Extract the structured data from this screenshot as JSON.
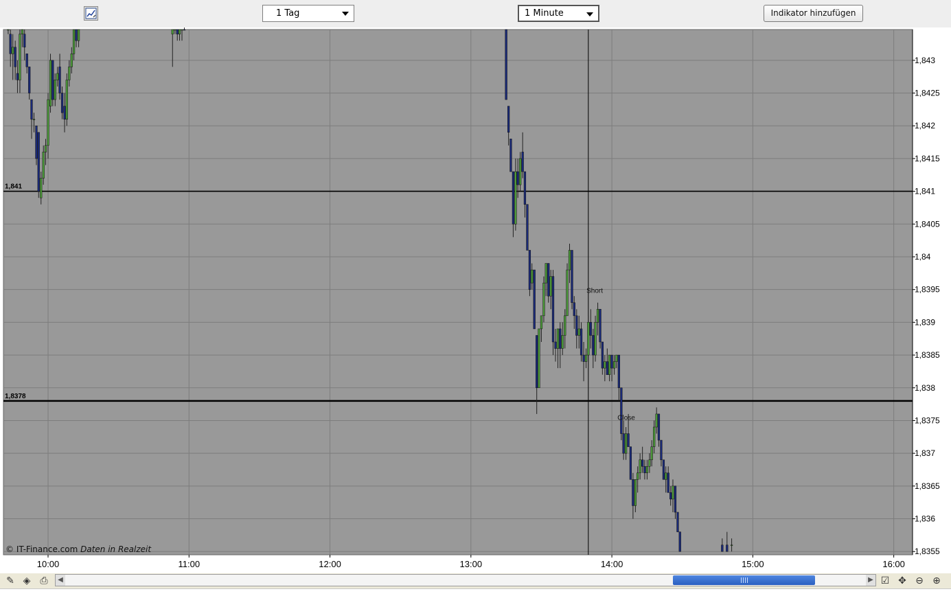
{
  "toolbar": {
    "range_value": "1 Tag",
    "interval_value": "1 Minute",
    "indicator_button": "Indikator hinzufügen"
  },
  "credit": {
    "copyright": "© IT-Finance.com",
    "realtime": "Daten in Realzeit"
  },
  "colors": {
    "plot_bg": "#999999",
    "grid": "#7d7d7d",
    "up_candle": "#4c9a3a",
    "down_candle": "#1a2a78",
    "line": "#000000"
  },
  "chart_data": {
    "type": "candlestick",
    "y_ticks": [
      "1,843",
      "1,8425",
      "1,842",
      "1,8415",
      "1,841",
      "1,8405",
      "1,84",
      "1,8395",
      "1,839",
      "1,8385",
      "1,838",
      "1,8375",
      "1,837",
      "1,8365",
      "1,836",
      "1,8355"
    ],
    "ylim": [
      1.83545,
      1.84347
    ],
    "x_ticks": [
      "10:00",
      "11:00",
      "12:00",
      "13:00",
      "14:00",
      "15:00",
      "16:00"
    ],
    "xlim_hours": [
      9.6833,
      16.1333
    ],
    "hlines": [
      {
        "value": 1.841,
        "label": "1,841"
      },
      {
        "value": 1.8378,
        "label": "1,8378"
      }
    ],
    "vline_time": 13.833,
    "annotations": [
      {
        "text": "Short",
        "time": 13.82,
        "price": 1.83945
      },
      {
        "text": "Close",
        "time": 14.04,
        "price": 1.83751
      }
    ],
    "candles": [
      [
        9.717,
        1.8435,
        1.8436,
        1.8434,
        1.8435
      ],
      [
        9.733,
        1.8434,
        1.8435,
        1.8429,
        1.8431
      ],
      [
        9.75,
        1.8431,
        1.8434,
        1.8427,
        1.8432
      ],
      [
        9.767,
        1.8432,
        1.8433,
        1.8427,
        1.8429
      ],
      [
        9.783,
        1.8428,
        1.843,
        1.8425,
        1.8427
      ],
      [
        9.8,
        1.8427,
        1.8435,
        1.8425,
        1.8434
      ],
      [
        9.817,
        1.8434,
        1.8436,
        1.8432,
        1.8435
      ],
      [
        9.833,
        1.8434,
        1.8435,
        1.843,
        1.8432
      ],
      [
        9.85,
        1.8431,
        1.8431,
        1.8428,
        1.8429
      ],
      [
        9.867,
        1.8429,
        1.8429,
        1.8424,
        1.8425
      ],
      [
        9.883,
        1.8424,
        1.8424,
        1.8418,
        1.8421
      ],
      [
        9.9,
        1.8421,
        1.8422,
        1.8419,
        1.8421
      ],
      [
        9.917,
        1.842,
        1.842,
        1.8414,
        1.8415
      ],
      [
        9.933,
        1.8419,
        1.8419,
        1.8409,
        1.841
      ],
      [
        9.95,
        1.8409,
        1.8413,
        1.8408,
        1.8412
      ],
      [
        9.967,
        1.8412,
        1.8417,
        1.8411,
        1.8416
      ],
      [
        9.983,
        1.8416,
        1.8418,
        1.8414,
        1.8417
      ],
      [
        10.0,
        1.8417,
        1.8425,
        1.8415,
        1.8424
      ],
      [
        10.017,
        1.8423,
        1.8431,
        1.8422,
        1.843
      ],
      [
        10.033,
        1.843,
        1.843,
        1.8423,
        1.8424
      ],
      [
        10.05,
        1.8424,
        1.8428,
        1.8423,
        1.8427
      ],
      [
        10.067,
        1.8427,
        1.8429,
        1.8426,
        1.8428
      ],
      [
        10.083,
        1.8429,
        1.8431,
        1.8424,
        1.8425
      ],
      [
        10.1,
        1.8425,
        1.8426,
        1.8421,
        1.8422
      ],
      [
        10.117,
        1.8423,
        1.8425,
        1.8419,
        1.8421
      ],
      [
        10.133,
        1.8421,
        1.8428,
        1.842,
        1.8427
      ],
      [
        10.15,
        1.8427,
        1.843,
        1.8426,
        1.8429
      ],
      [
        10.167,
        1.8429,
        1.8432,
        1.8428,
        1.8431
      ],
      [
        10.183,
        1.8431,
        1.8436,
        1.843,
        1.8435
      ],
      [
        10.2,
        1.8435,
        1.8436,
        1.8432,
        1.8433
      ],
      [
        10.217,
        1.8433,
        1.8436,
        1.8432,
        1.8436
      ],
      [
        10.883,
        1.8434,
        1.8436,
        1.8429,
        1.8435
      ],
      [
        10.9,
        1.8435,
        1.8436,
        1.8434,
        1.8436
      ],
      [
        10.917,
        1.8436,
        1.8437,
        1.8433,
        1.8434
      ],
      [
        10.933,
        1.8434,
        1.8436,
        1.8433,
        1.8435
      ],
      [
        10.95,
        1.8435,
        1.8436,
        1.8433,
        1.8435
      ],
      [
        10.967,
        1.8436,
        1.8437,
        1.8435,
        1.8435
      ],
      [
        13.25,
        1.8437,
        1.8437,
        1.8424,
        1.8424
      ],
      [
        13.267,
        1.8423,
        1.8423,
        1.8417,
        1.8419
      ],
      [
        13.283,
        1.8418,
        1.8418,
        1.8413,
        1.8413
      ],
      [
        13.3,
        1.8413,
        1.8413,
        1.8403,
        1.8405
      ],
      [
        13.317,
        1.8405,
        1.8415,
        1.8404,
        1.8413
      ],
      [
        13.333,
        1.8413,
        1.8415,
        1.8409,
        1.8411
      ],
      [
        13.35,
        1.8411,
        1.8416,
        1.841,
        1.8415
      ],
      [
        13.367,
        1.8416,
        1.8419,
        1.8412,
        1.8413
      ],
      [
        13.383,
        1.8413,
        1.8413,
        1.8406,
        1.8408
      ],
      [
        13.4,
        1.8408,
        1.8408,
        1.8401,
        1.8401
      ],
      [
        13.417,
        1.8401,
        1.8401,
        1.8394,
        1.8395
      ],
      [
        13.433,
        1.8396,
        1.8399,
        1.8395,
        1.8398
      ],
      [
        13.45,
        1.8398,
        1.8398,
        1.8389,
        1.8389
      ],
      [
        13.467,
        1.8388,
        1.8388,
        1.8376,
        1.838
      ],
      [
        13.483,
        1.838,
        1.8389,
        1.838,
        1.8389
      ],
      [
        13.5,
        1.8389,
        1.8391,
        1.8387,
        1.8391
      ],
      [
        13.517,
        1.8391,
        1.8397,
        1.839,
        1.8396
      ],
      [
        13.533,
        1.8396,
        1.8399,
        1.8394,
        1.8399
      ],
      [
        13.55,
        1.8399,
        1.8399,
        1.8393,
        1.8394
      ],
      [
        13.567,
        1.8394,
        1.8398,
        1.8392,
        1.8397
      ],
      [
        13.583,
        1.8397,
        1.8398,
        1.8385,
        1.8387
      ],
      [
        13.6,
        1.8387,
        1.8389,
        1.8384,
        1.8386
      ],
      [
        13.617,
        1.8386,
        1.8389,
        1.8383,
        1.8389
      ],
      [
        13.633,
        1.8389,
        1.839,
        1.8383,
        1.8386
      ],
      [
        13.65,
        1.8386,
        1.839,
        1.8385,
        1.8388
      ],
      [
        13.667,
        1.8388,
        1.8392,
        1.8386,
        1.8391
      ],
      [
        13.683,
        1.8391,
        1.8399,
        1.8391,
        1.8398
      ],
      [
        13.7,
        1.8398,
        1.8402,
        1.8396,
        1.8401
      ],
      [
        13.717,
        1.8401,
        1.8401,
        1.8392,
        1.8393
      ],
      [
        13.733,
        1.8393,
        1.8394,
        1.8389,
        1.8391
      ],
      [
        13.75,
        1.8391,
        1.8392,
        1.8386,
        1.8388
      ],
      [
        13.767,
        1.8388,
        1.8391,
        1.8386,
        1.8389
      ],
      [
        13.783,
        1.8389,
        1.839,
        1.8384,
        1.8385
      ],
      [
        13.8,
        1.8385,
        1.8387,
        1.8381,
        1.8384
      ],
      [
        13.817,
        1.8384,
        1.8386,
        1.8383,
        1.8385
      ],
      [
        13.833,
        1.8385,
        1.8391,
        1.8384,
        1.839
      ],
      [
        13.85,
        1.839,
        1.8392,
        1.8386,
        1.8388
      ],
      [
        13.867,
        1.8388,
        1.8389,
        1.8383,
        1.8385
      ],
      [
        13.883,
        1.8385,
        1.8391,
        1.8384,
        1.839
      ],
      [
        13.9,
        1.839,
        1.8393,
        1.8388,
        1.8392
      ],
      [
        13.917,
        1.8392,
        1.8392,
        1.8386,
        1.8387
      ],
      [
        13.933,
        1.8387,
        1.8387,
        1.8382,
        1.8383
      ],
      [
        13.95,
        1.8383,
        1.8385,
        1.8381,
        1.8384
      ],
      [
        13.967,
        1.8384,
        1.8386,
        1.8382,
        1.8382
      ],
      [
        13.983,
        1.8382,
        1.8385,
        1.8381,
        1.8385
      ],
      [
        14.0,
        1.8385,
        1.8385,
        1.8381,
        1.8383
      ],
      [
        14.017,
        1.8383,
        1.8385,
        1.8382,
        1.8384
      ],
      [
        14.033,
        1.8384,
        1.8385,
        1.8383,
        1.8385
      ],
      [
        14.05,
        1.8385,
        1.8385,
        1.8378,
        1.838
      ],
      [
        14.067,
        1.838,
        1.838,
        1.8372,
        1.8373
      ],
      [
        14.083,
        1.8373,
        1.8375,
        1.8369,
        1.837
      ],
      [
        14.1,
        1.837,
        1.8374,
        1.8369,
        1.8373
      ],
      [
        14.117,
        1.8373,
        1.8376,
        1.8371,
        1.8371
      ],
      [
        14.133,
        1.8371,
        1.8371,
        1.8366,
        1.8366
      ],
      [
        14.15,
        1.8366,
        1.8367,
        1.836,
        1.8362
      ],
      [
        14.167,
        1.8362,
        1.8366,
        1.8361,
        1.8366
      ],
      [
        14.183,
        1.8366,
        1.8368,
        1.8364,
        1.8367
      ],
      [
        14.2,
        1.8367,
        1.837,
        1.8366,
        1.8369
      ],
      [
        14.217,
        1.8369,
        1.8371,
        1.8367,
        1.8368
      ],
      [
        14.233,
        1.8368,
        1.8369,
        1.8366,
        1.8367
      ],
      [
        14.25,
        1.8367,
        1.8369,
        1.8366,
        1.8368
      ],
      [
        14.267,
        1.8368,
        1.837,
        1.8367,
        1.8369
      ],
      [
        14.283,
        1.8369,
        1.8372,
        1.8368,
        1.8371
      ],
      [
        14.3,
        1.8371,
        1.8375,
        1.837,
        1.8374
      ],
      [
        14.317,
        1.8374,
        1.8377,
        1.8373,
        1.8376
      ],
      [
        14.333,
        1.8376,
        1.8376,
        1.8371,
        1.8372
      ],
      [
        14.35,
        1.8372,
        1.8372,
        1.8368,
        1.8369
      ],
      [
        14.367,
        1.8369,
        1.8369,
        1.8366,
        1.8366
      ],
      [
        14.383,
        1.8366,
        1.8368,
        1.8364,
        1.8367
      ],
      [
        14.4,
        1.8367,
        1.8368,
        1.8364,
        1.8364
      ],
      [
        14.417,
        1.8364,
        1.8365,
        1.8362,
        1.8363
      ],
      [
        14.433,
        1.8363,
        1.8366,
        1.8361,
        1.8365
      ],
      [
        14.45,
        1.8365,
        1.8365,
        1.836,
        1.8361
      ],
      [
        14.467,
        1.8361,
        1.8361,
        1.8358,
        1.8358
      ],
      [
        14.483,
        1.8358,
        1.8358,
        1.8355,
        1.8355
      ],
      [
        14.783,
        1.8356,
        1.8357,
        1.8355,
        1.8355
      ],
      [
        14.817,
        1.8356,
        1.8358,
        1.8355,
        1.8355
      ],
      [
        14.85,
        1.8356,
        1.8357,
        1.8355,
        1.8356
      ]
    ]
  }
}
